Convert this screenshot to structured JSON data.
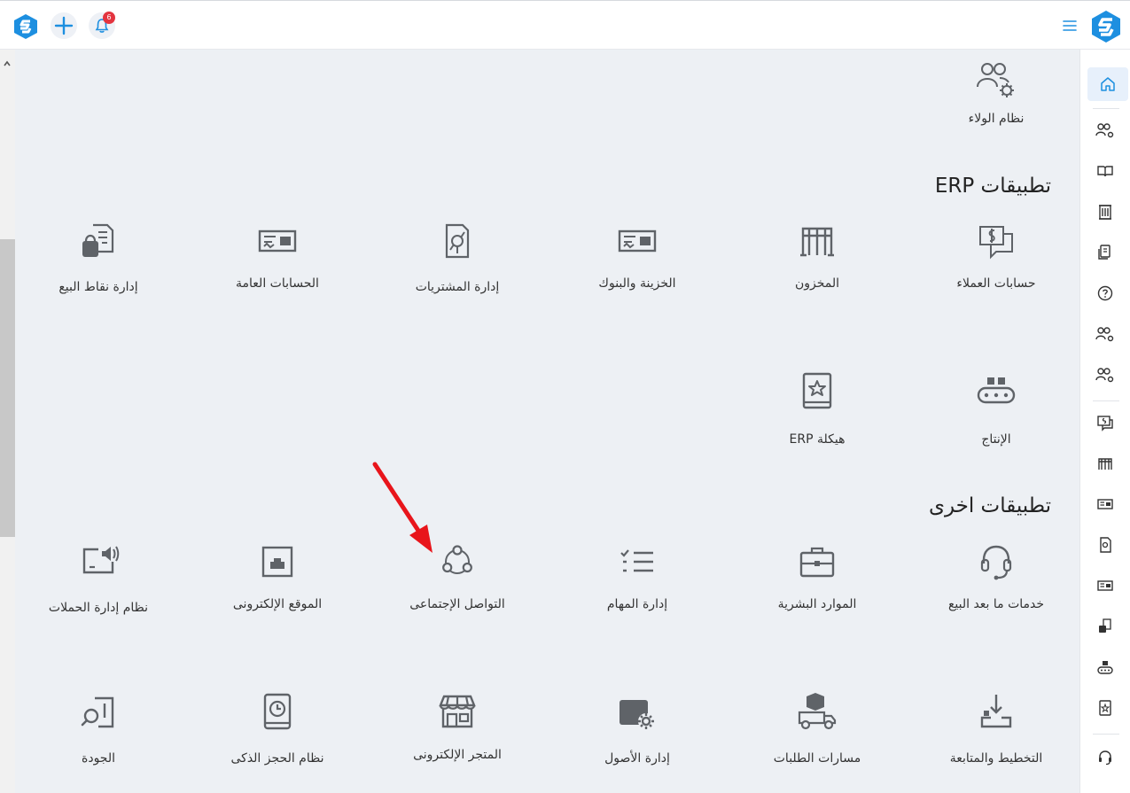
{
  "topbar": {
    "notification_count": "6"
  },
  "sections": {
    "erp_title": "تطبيقات ERP",
    "other_title": "تطبيقات اخرى"
  },
  "apps": {
    "loyalty": "نظام الولاء",
    "customer_accounts": "حسابات العملاء",
    "inventory": "المخزون",
    "treasury_banks": "الخزينة والبنوك",
    "purchases": "إدارة المشتريات",
    "general_accounts": "الحسابات العامة",
    "pos": "إدارة نقاط البيع",
    "production": "الإنتاج",
    "erp_structure": "هيكلة ERP",
    "after_sales": "خدمات ما بعد البيع",
    "hr": "الموارد البشرية",
    "tasks": "إدارة المهام",
    "social": "التواصل الإجتماعى",
    "website": "الموقع الإلكترونى",
    "campaigns": "نظام إدارة الحملات",
    "planning": "التخطيط والمتابعة",
    "order_routes": "مسارات الطلبات",
    "assets": "إدارة الأصول",
    "ecommerce": "المتجر الإلكترونى",
    "smart_booking": "نظام الحجز الذكى",
    "quality": "الجودة"
  },
  "colors": {
    "brand": "#1d8fe0",
    "icon": "#5f6368",
    "badge": "#e3343f",
    "annotation_arrow": "#e8151b"
  }
}
